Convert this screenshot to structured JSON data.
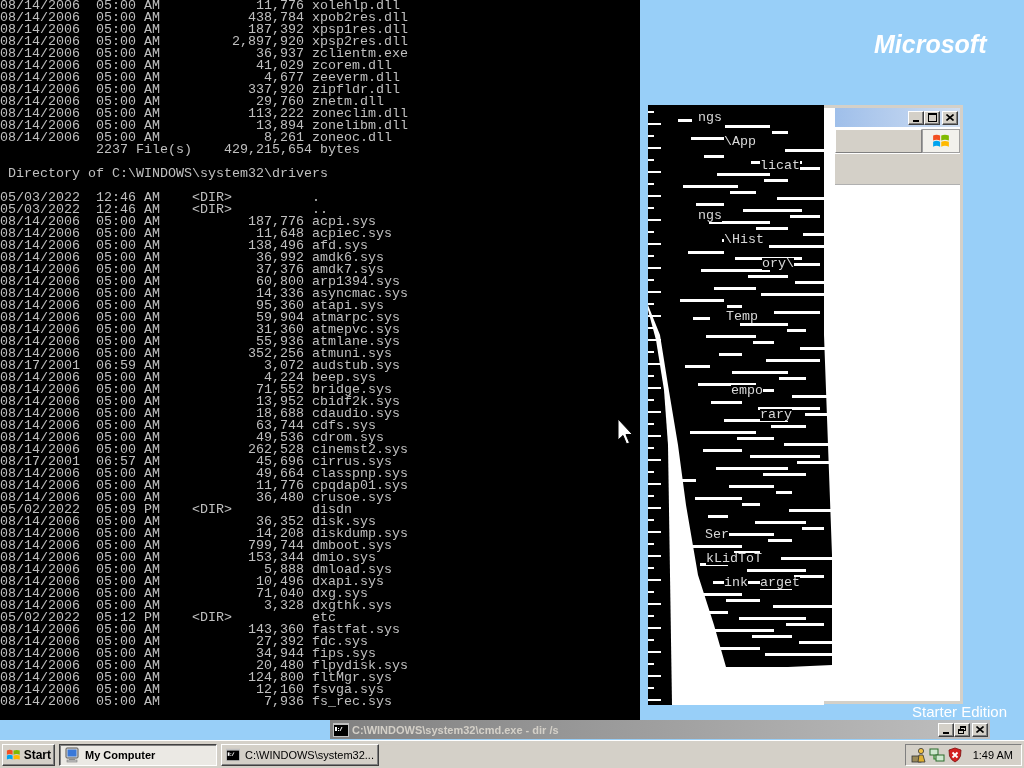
{
  "desktop": {
    "logo_text": "Microsoft",
    "edition_text": "Starter Edition"
  },
  "console": {
    "previous_entries": [
      {
        "kind": "file",
        "date": "08/14/2006",
        "time": "05:00 AM",
        "size": "11,776",
        "name": "xolehlp.dll"
      },
      {
        "kind": "file",
        "date": "08/14/2006",
        "time": "05:00 AM",
        "size": "438,784",
        "name": "xpob2res.dll"
      },
      {
        "kind": "file",
        "date": "08/14/2006",
        "time": "05:00 AM",
        "size": "187,392",
        "name": "xpsp1res.dll"
      },
      {
        "kind": "file",
        "date": "08/14/2006",
        "time": "05:00 AM",
        "size": "2,897,920",
        "name": "xpsp2res.dll"
      },
      {
        "kind": "file",
        "date": "08/14/2006",
        "time": "05:00 AM",
        "size": "36,937",
        "name": "zclientm.exe"
      },
      {
        "kind": "file",
        "date": "08/14/2006",
        "time": "05:00 AM",
        "size": "41,029",
        "name": "zcorem.dll"
      },
      {
        "kind": "file",
        "date": "08/14/2006",
        "time": "05:00 AM",
        "size": "4,677",
        "name": "zeeverm.dll"
      },
      {
        "kind": "file",
        "date": "08/14/2006",
        "time": "05:00 AM",
        "size": "337,920",
        "name": "zipfldr.dll"
      },
      {
        "kind": "file",
        "date": "08/14/2006",
        "time": "05:00 AM",
        "size": "29,760",
        "name": "znetm.dll"
      },
      {
        "kind": "file",
        "date": "08/14/2006",
        "time": "05:00 AM",
        "size": "113,222",
        "name": "zoneclim.dll"
      },
      {
        "kind": "file",
        "date": "08/14/2006",
        "time": "05:00 AM",
        "size": "13,894",
        "name": "zonelibm.dll"
      },
      {
        "kind": "file",
        "date": "08/14/2006",
        "time": "05:00 AM",
        "size": "8,261",
        "name": "zoneoc.dll"
      }
    ],
    "previous_summary": {
      "file_count": "2237 File(s)",
      "total": "429,215,654 bytes"
    },
    "directory_heading": "Directory of C:\\WINDOWS\\system32\\drivers",
    "entries": [
      {
        "kind": "dir",
        "date": "05/03/2022",
        "time": "12:46 AM",
        "tag": "<DIR>",
        "name": "."
      },
      {
        "kind": "dir",
        "date": "05/03/2022",
        "time": "12:46 AM",
        "tag": "<DIR>",
        "name": ".."
      },
      {
        "kind": "file",
        "date": "08/14/2006",
        "time": "05:00 AM",
        "size": "187,776",
        "name": "acpi.sys"
      },
      {
        "kind": "file",
        "date": "08/14/2006",
        "time": "05:00 AM",
        "size": "11,648",
        "name": "acpiec.sys"
      },
      {
        "kind": "file",
        "date": "08/14/2006",
        "time": "05:00 AM",
        "size": "138,496",
        "name": "afd.sys"
      },
      {
        "kind": "file",
        "date": "08/14/2006",
        "time": "05:00 AM",
        "size": "36,992",
        "name": "amdk6.sys"
      },
      {
        "kind": "file",
        "date": "08/14/2006",
        "time": "05:00 AM",
        "size": "37,376",
        "name": "amdk7.sys"
      },
      {
        "kind": "file",
        "date": "08/14/2006",
        "time": "05:00 AM",
        "size": "60,800",
        "name": "arp1394.sys"
      },
      {
        "kind": "file",
        "date": "08/14/2006",
        "time": "05:00 AM",
        "size": "14,336",
        "name": "asyncmac.sys"
      },
      {
        "kind": "file",
        "date": "08/14/2006",
        "time": "05:00 AM",
        "size": "95,360",
        "name": "atapi.sys"
      },
      {
        "kind": "file",
        "date": "08/14/2006",
        "time": "05:00 AM",
        "size": "59,904",
        "name": "atmarpc.sys"
      },
      {
        "kind": "file",
        "date": "08/14/2006",
        "time": "05:00 AM",
        "size": "31,360",
        "name": "atmepvc.sys"
      },
      {
        "kind": "file",
        "date": "08/14/2006",
        "time": "05:00 AM",
        "size": "55,936",
        "name": "atmlane.sys"
      },
      {
        "kind": "file",
        "date": "08/14/2006",
        "time": "05:00 AM",
        "size": "352,256",
        "name": "atmuni.sys"
      },
      {
        "kind": "file",
        "date": "08/17/2001",
        "time": "06:59 AM",
        "size": "3,072",
        "name": "audstub.sys"
      },
      {
        "kind": "file",
        "date": "08/14/2006",
        "time": "05:00 AM",
        "size": "4,224",
        "name": "beep.sys"
      },
      {
        "kind": "file",
        "date": "08/14/2006",
        "time": "05:00 AM",
        "size": "71,552",
        "name": "bridge.sys"
      },
      {
        "kind": "file",
        "date": "08/14/2006",
        "time": "05:00 AM",
        "size": "13,952",
        "name": "cbidf2k.sys"
      },
      {
        "kind": "file",
        "date": "08/14/2006",
        "time": "05:00 AM",
        "size": "18,688",
        "name": "cdaudio.sys"
      },
      {
        "kind": "file",
        "date": "08/14/2006",
        "time": "05:00 AM",
        "size": "63,744",
        "name": "cdfs.sys"
      },
      {
        "kind": "file",
        "date": "08/14/2006",
        "time": "05:00 AM",
        "size": "49,536",
        "name": "cdrom.sys"
      },
      {
        "kind": "file",
        "date": "08/14/2006",
        "time": "05:00 AM",
        "size": "262,528",
        "name": "cinemst2.sys"
      },
      {
        "kind": "file",
        "date": "08/17/2001",
        "time": "06:57 AM",
        "size": "45,696",
        "name": "cirrus.sys"
      },
      {
        "kind": "file",
        "date": "08/14/2006",
        "time": "05:00 AM",
        "size": "49,664",
        "name": "classpnp.sys"
      },
      {
        "kind": "file",
        "date": "08/14/2006",
        "time": "05:00 AM",
        "size": "11,776",
        "name": "cpqdap01.sys"
      },
      {
        "kind": "file",
        "date": "08/14/2006",
        "time": "05:00 AM",
        "size": "36,480",
        "name": "crusoe.sys"
      },
      {
        "kind": "dir",
        "date": "05/02/2022",
        "time": "05:09 PM",
        "tag": "<DIR>",
        "name": "disdn"
      },
      {
        "kind": "file",
        "date": "08/14/2006",
        "time": "05:00 AM",
        "size": "36,352",
        "name": "disk.sys"
      },
      {
        "kind": "file",
        "date": "08/14/2006",
        "time": "05:00 AM",
        "size": "14,208",
        "name": "diskdump.sys"
      },
      {
        "kind": "file",
        "date": "08/14/2006",
        "time": "05:00 AM",
        "size": "799,744",
        "name": "dmboot.sys"
      },
      {
        "kind": "file",
        "date": "08/14/2006",
        "time": "05:00 AM",
        "size": "153,344",
        "name": "dmio.sys"
      },
      {
        "kind": "file",
        "date": "08/14/2006",
        "time": "05:00 AM",
        "size": "5,888",
        "name": "dmload.sys"
      },
      {
        "kind": "file",
        "date": "08/14/2006",
        "time": "05:00 AM",
        "size": "10,496",
        "name": "dxapi.sys"
      },
      {
        "kind": "file",
        "date": "08/14/2006",
        "time": "05:00 AM",
        "size": "71,040",
        "name": "dxg.sys"
      },
      {
        "kind": "file",
        "date": "08/14/2006",
        "time": "05:00 AM",
        "size": "3,328",
        "name": "dxgthk.sys"
      },
      {
        "kind": "dir",
        "date": "05/02/2022",
        "time": "05:12 PM",
        "tag": "<DIR>",
        "name": "etc"
      },
      {
        "kind": "file",
        "date": "08/14/2006",
        "time": "05:00 AM",
        "size": "143,360",
        "name": "fastfat.sys"
      },
      {
        "kind": "file",
        "date": "08/14/2006",
        "time": "05:00 AM",
        "size": "27,392",
        "name": "fdc.sys"
      },
      {
        "kind": "file",
        "date": "08/14/2006",
        "time": "05:00 AM",
        "size": "34,944",
        "name": "fips.sys"
      },
      {
        "kind": "file",
        "date": "08/14/2006",
        "time": "05:00 AM",
        "size": "20,480",
        "name": "flpydisk.sys"
      },
      {
        "kind": "file",
        "date": "08/14/2006",
        "time": "05:00 AM",
        "size": "124,800",
        "name": "fltMgr.sys"
      },
      {
        "kind": "file",
        "date": "08/14/2006",
        "time": "05:00 AM",
        "size": "12,160",
        "name": "fsvga.sys"
      },
      {
        "kind": "file",
        "date": "08/14/2006",
        "time": "05:00 AM",
        "size": "7,936",
        "name": "fs_rec.sys"
      }
    ]
  },
  "glitched_window": {
    "text_fragments": [
      "ngs",
      "\\App",
      "licat",
      "ngs",
      "\\Hist",
      "ory\\",
      "Temp",
      "empo",
      "rary",
      "Ser",
      "kLidToT",
      "ink",
      "arget"
    ]
  },
  "console_title_bar": {
    "title": "C:\\WINDOWS\\system32\\cmd.exe - dir /s"
  },
  "taskbar": {
    "start": "Start",
    "buttons": [
      {
        "kind": "explorer",
        "label": "My Computer",
        "selected": true
      },
      {
        "kind": "console",
        "label": "C:\\WINDOWS\\system32...",
        "selected": false
      }
    ],
    "clock": "1:49 AM"
  }
}
